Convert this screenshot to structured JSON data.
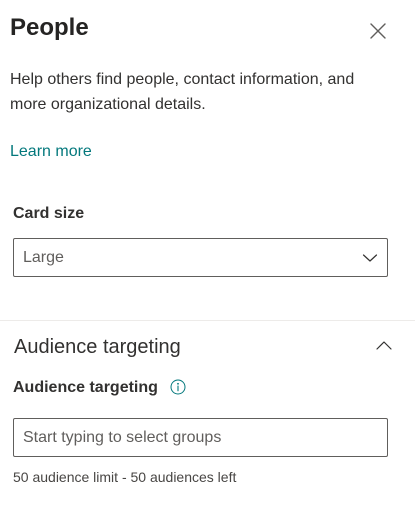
{
  "panel": {
    "title": "People",
    "description": "Help others find people, contact information, and more organizational details.",
    "learn_more": "Learn more"
  },
  "card_size": {
    "label": "Card size",
    "selected": "Large"
  },
  "audience_section": {
    "title": "Audience targeting",
    "field_label": "Audience targeting",
    "placeholder": "Start typing to select groups",
    "value": "",
    "helper": "50 audience limit - 50 audiences left"
  },
  "icons": {
    "close": "close-icon",
    "dropdown": "chevron-down-icon",
    "collapse": "chevron-up-icon",
    "info": "info-icon"
  },
  "colors": {
    "link": "#03787c",
    "info": "#03787c",
    "border": "#605e5c"
  }
}
